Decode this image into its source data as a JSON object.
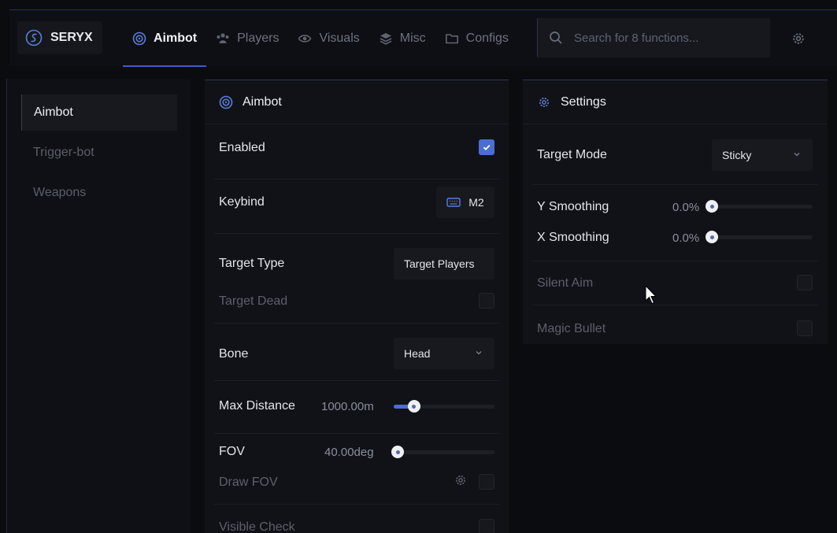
{
  "brand": {
    "name": "SERYX"
  },
  "tabs": [
    {
      "label": "Aimbot",
      "icon": "target-icon",
      "active": true
    },
    {
      "label": "Players",
      "icon": "players-icon",
      "active": false
    },
    {
      "label": "Visuals",
      "icon": "eye-icon",
      "active": false
    },
    {
      "label": "Misc",
      "icon": "layers-icon",
      "active": false
    },
    {
      "label": "Configs",
      "icon": "folder-icon",
      "active": false
    }
  ],
  "search": {
    "placeholder": "Search for 8 functions..."
  },
  "sidebar": {
    "items": [
      {
        "label": "Aimbot",
        "active": true
      },
      {
        "label": "Trigger-bot",
        "active": false
      },
      {
        "label": "Weapons",
        "active": false
      }
    ]
  },
  "aimbot_panel": {
    "title": "Aimbot",
    "enabled_label": "Enabled",
    "enabled": true,
    "keybind_label": "Keybind",
    "keybind_value": "M2",
    "target_type_label": "Target Type",
    "target_type_value": "Target Players",
    "target_dead_label": "Target Dead",
    "target_dead": false,
    "bone_label": "Bone",
    "bone_value": "Head",
    "max_distance_label": "Max Distance",
    "max_distance_value": "1000.00m",
    "max_distance_fill": 0.2,
    "fov_label": "FOV",
    "fov_value": "40.00deg",
    "fov_fill": 0.0,
    "draw_fov_label": "Draw FOV",
    "draw_fov": false,
    "visible_check_label": "Visible Check",
    "visible_check": false
  },
  "settings_panel": {
    "title": "Settings",
    "target_mode_label": "Target Mode",
    "target_mode_value": "Sticky",
    "y_smoothing_label": "Y Smoothing",
    "y_smoothing_value": "0.0%",
    "y_smoothing_fill": 0.0,
    "x_smoothing_label": "X Smoothing",
    "x_smoothing_value": "0.0%",
    "x_smoothing_fill": 0.0,
    "silent_aim_label": "Silent Aim",
    "silent_aim": false,
    "magic_bullet_label": "Magic Bullet",
    "magic_bullet": false
  },
  "colors": {
    "accent": "#4a6fd0",
    "background": "#0b0c10",
    "panel": "#111217"
  }
}
